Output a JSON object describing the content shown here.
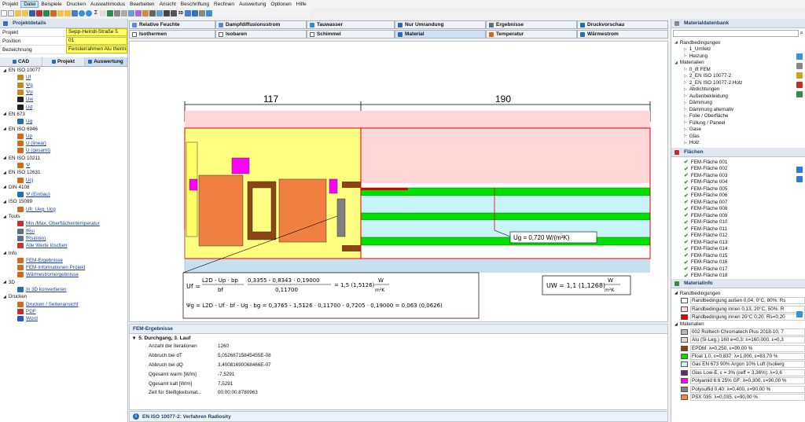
{
  "menu": [
    "Projekt",
    "Datei",
    "Beispiele",
    "Drucken",
    "Auswahlmodus",
    "Bearbeiten",
    "Ansicht",
    "Beschriftung",
    "Rechnen",
    "Auswertung",
    "Optionen",
    "Hilfe"
  ],
  "project_panel": {
    "title": "Projektdetails",
    "rows": [
      {
        "key": "Projekt",
        "value": "Sepp-Heindl-Straße 5"
      },
      {
        "key": "Position",
        "value": "01"
      },
      {
        "key": "Bezeichnung",
        "value": "Fensterrahmen Alu thermi"
      }
    ],
    "tabs": [
      "CAD",
      "Projekt",
      "Auswertung"
    ]
  },
  "left_tree": [
    {
      "label": "EN ISO 10077",
      "level": 0,
      "link": false
    },
    {
      "label": "Uf",
      "level": 2,
      "link": true,
      "color": "#c08a20"
    },
    {
      "label": "Ψg",
      "level": 2,
      "link": true,
      "color": "#c08a20"
    },
    {
      "label": "Ψp",
      "level": 2,
      "link": true,
      "color": "#c08a20"
    },
    {
      "label": "Uw",
      "level": 2,
      "link": true,
      "color": "#222"
    },
    {
      "label": "Ud",
      "level": 2,
      "link": true,
      "color": "#222"
    },
    {
      "label": "EN 673",
      "level": 0,
      "link": false
    },
    {
      "label": "Ug",
      "level": 2,
      "link": true,
      "color": "#2a6ab0"
    },
    {
      "label": "EN ISO 6946",
      "level": 0,
      "link": false
    },
    {
      "label": "Up",
      "level": 2,
      "link": true,
      "color": "#d06a20"
    },
    {
      "label": "U (linear)",
      "level": 2,
      "link": true,
      "color": "#d06a20"
    },
    {
      "label": "U (gesamt)",
      "level": 2,
      "link": true,
      "color": "#d06a20"
    },
    {
      "label": "EN ISO 10211",
      "level": 0,
      "link": false
    },
    {
      "label": "Ψ",
      "level": 2,
      "link": true,
      "color": "#d06a20"
    },
    {
      "label": "EN ISO 12631",
      "level": 0,
      "link": false
    },
    {
      "label": "Ucj",
      "level": 2,
      "link": true,
      "color": "#d06a20"
    },
    {
      "label": "DIN 4108",
      "level": 0,
      "link": false
    },
    {
      "label": "Ψ (Einbau)",
      "level": 2,
      "link": true,
      "color": "#2a6ab0"
    },
    {
      "label": "ISO 15099",
      "level": 0,
      "link": false
    },
    {
      "label": "Ufr, Ueg, Ucg",
      "level": 2,
      "link": true,
      "color": "#d06a20"
    },
    {
      "label": "Tools",
      "level": 0,
      "link": false
    },
    {
      "label": "Min./Max. Oberflächentemperatur",
      "level": 2,
      "link": true,
      "color": "#c03030"
    },
    {
      "label": "fRsi",
      "level": 2,
      "link": true,
      "color": "#607080"
    },
    {
      "label": "fRsi(min)",
      "level": 2,
      "link": true,
      "color": "#607080"
    },
    {
      "label": "Alle Werte löschen",
      "level": 2,
      "link": true,
      "color": "#d03030"
    },
    {
      "label": "Info",
      "level": 0,
      "link": false
    },
    {
      "label": "FEM-Ergebnisse",
      "level": 2,
      "link": true,
      "color": "#d06a20"
    },
    {
      "label": "FEM-Informationen Projekt",
      "level": 2,
      "link": true,
      "color": "#d06a20"
    },
    {
      "label": "Wärmestromergebnisse",
      "level": 2,
      "link": true,
      "color": "#d06a20"
    },
    {
      "label": "3D",
      "level": 0,
      "link": false
    },
    {
      "label": "In 3D konvertieren",
      "level": 2,
      "link": true,
      "color": "#2a6ab0"
    },
    {
      "label": "Drucken",
      "level": 0,
      "link": false
    },
    {
      "label": "Drucken / Seitenansicht",
      "level": 2,
      "link": true,
      "color": "#d06a20"
    },
    {
      "label": "PDF",
      "level": 2,
      "link": true,
      "color": "#c03030"
    },
    {
      "label": "Word",
      "level": 2,
      "link": true,
      "color": "#2a5ab0"
    }
  ],
  "view_tabs_row1": [
    "Relative Feuchte",
    "Dampfdiffusionsstrom",
    "Tauwasser",
    "Nur Umrandung",
    "Ergebnisse",
    "Druckvorschau"
  ],
  "view_tabs_row2": [
    "Isothermen",
    "Isobaren",
    "Schimmel",
    "Material",
    "Temperatur",
    "Wärmestrom"
  ],
  "drawing": {
    "dim_left": "117",
    "dim_right": "190",
    "ug_label": "Ug = 0,720 W/(m²K)",
    "uf_formula": "Uf = (L2D - Up · bp) / bf = (0,3355 - 0,8343 · 0,19000) / 0,11700 = 1,5 (1,5126) W/m²K",
    "uf_lhs": "Uf =",
    "uf_num": "L2D - Up · bp",
    "uf_den": "bf",
    "uf_num2": "0,3355 - 0,8343 · 0,19000",
    "uf_den2": "0,11700",
    "uf_result": "= 1,5 (1,5126)",
    "unit_w": "W",
    "unit_m2k": "m²K",
    "unit_mk": "mK",
    "psi_formula": "Ψg = L2D - Uf · bf - Ug · bg = 0,3765 - 1,5126 · 0,11700 - 0,7205 · 0,19000 = 0,063 (0,0626)",
    "uw_formula": "UW = 1,1 (1,1268)"
  },
  "fem_results": {
    "title": "FEM-Ergebnisse",
    "section": "5. Durchgang, 3. Lauf",
    "rows": [
      {
        "key": "Anzahl der Iterationen",
        "value": "1260"
      },
      {
        "key": "Abbruch bei dT",
        "value": "5,05268715845455E-08"
      },
      {
        "key": "Abbruch bei dQ",
        "value": "3,40081690068466E-07"
      },
      {
        "key": "Qgesamt warm [W/m]",
        "value": "-7,5291"
      },
      {
        "key": "Qgesamt kalt [W/m]",
        "value": "7,5291"
      },
      {
        "key": "Zeit für Steifigkeitsmat...",
        "value": "00:00:00.8780963"
      }
    ]
  },
  "status": "EN ISO 10077-2: Verfahren Radiosity",
  "material_db": {
    "title": "Materialdatenbank",
    "search_placeholder": "",
    "tree": [
      {
        "label": "Randbedingungen",
        "level": 0
      },
      {
        "label": "1_Umfeld",
        "level": 1
      },
      {
        "label": "Heizung",
        "level": 1
      },
      {
        "label": "Materialien",
        "level": 0
      },
      {
        "label": "0_ift FEM",
        "level": 1
      },
      {
        "label": "2_EN ISO 10077-2",
        "level": 1
      },
      {
        "label": "2_EN ISO 10077-2 Holz",
        "level": 1
      },
      {
        "label": "Abdichtungen",
        "level": 1
      },
      {
        "label": "Außenbekleidung",
        "level": 1
      },
      {
        "label": "Dämmung",
        "level": 1
      },
      {
        "label": "Dämmung alternativ",
        "level": 1
      },
      {
        "label": "Folie / Oberfläche",
        "level": 1
      },
      {
        "label": "Füllung / Paneel",
        "level": 1
      },
      {
        "label": "Gase",
        "level": 1
      },
      {
        "label": "Glas",
        "level": 1
      },
      {
        "label": "Holz",
        "level": 1
      }
    ]
  },
  "flaechen": {
    "title": "Flächen",
    "items": [
      "FEM-Fläche 001",
      "FEM-Fläche 002",
      "FEM-Fläche 003",
      "FEM-Fläche 004",
      "FEM-Fläche 005",
      "FEM-Fläche 006",
      "FEM-Fläche 007",
      "FEM-Fläche 008",
      "FEM-Fläche 009",
      "FEM-Fläche 010",
      "FEM-Fläche 011",
      "FEM-Fläche 012",
      "FEM-Fläche 013",
      "FEM-Fläche 014",
      "FEM-Fläche 015",
      "FEM-Fläche 016",
      "FEM-Fläche 017",
      "FEM-Fläche 018"
    ]
  },
  "materialinfo": {
    "title": "Materialinfo",
    "groups": [
      {
        "label": "Randbedingungen",
        "items": [
          {
            "label": "Randbedingung außen 0,04, 0°C, 80%: Rs",
            "color": "#ffffff"
          },
          {
            "label": "Randbedingung innen 0,13, 20°C, 50%: R",
            "color": "#ffd7d7"
          },
          {
            "label": "Randbedingung innen 20°C 0.20: Rs=0,20",
            "color": "#e00000"
          }
        ]
      },
      {
        "label": "Materialien",
        "items": [
          {
            "label": "002 Rolltech Chromatech Plus 2018-10, 7",
            "color": "#b8b8b8"
          },
          {
            "label": "Alu (Si-Leg.) 160 e=0,3: λ=160,000, ε=0,3",
            "color": "#d8d8d8"
          },
          {
            "label": "EPDM: λ=0,250, ε=90,00 %",
            "color": "#8b4513"
          },
          {
            "label": "Float 1.0, ε=0,837: λ=1,000, ε=83,70 %",
            "color": "#00e000"
          },
          {
            "label": "Gas EN 673 90% Argon 10% Luft (Isolierg",
            "color": "#c8f4f8"
          },
          {
            "label": "Glas Low-E, ε = 3% (εeff = 3,36%): λ=3,6",
            "color": "#6b2a6b"
          },
          {
            "label": "Polyamid 6.6 25% GF: λ=0,300, ε=90,00 %",
            "color": "#ff00ff"
          },
          {
            "label": "Polysulfid 0,40: λ=0,400, ε=90,00 %",
            "color": "#808080"
          },
          {
            "label": "PSX 035: λ=0,035, ε=90,00 %",
            "color": "#ff8040"
          }
        ]
      }
    ]
  }
}
